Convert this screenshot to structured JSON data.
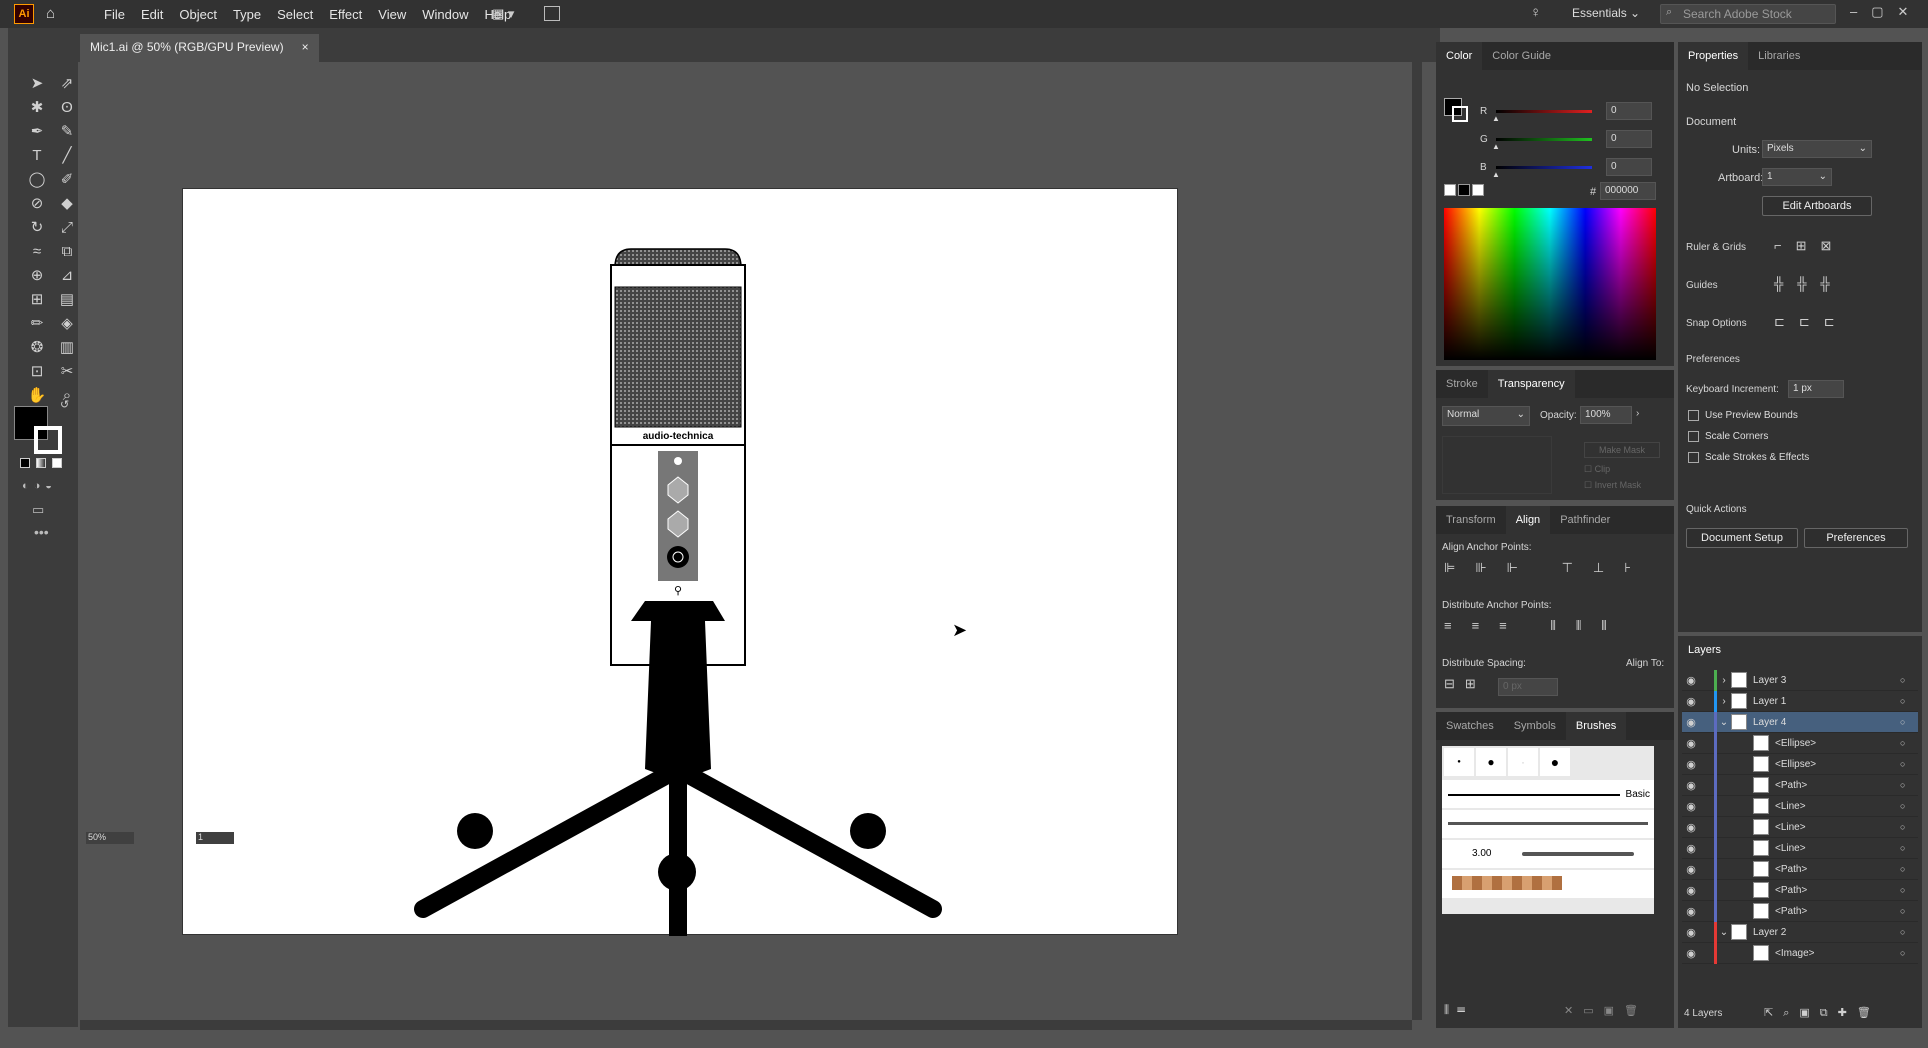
{
  "app": {
    "logo": "Ai",
    "home_icon": "home-icon"
  },
  "menu": [
    "File",
    "Edit",
    "Object",
    "Type",
    "Select",
    "Effect",
    "View",
    "Window",
    "Help"
  ],
  "header": {
    "workspace": "Essentials",
    "search_placeholder": "Search Adobe Stock"
  },
  "document": {
    "tab_title": "Mic1.ai @ 50% (RGB/GPU Preview)",
    "close": "×",
    "zoom": "50%",
    "artboard_num": "1"
  },
  "artwork": {
    "brand": "audio-technica"
  },
  "color_panel": {
    "tabs": [
      "Color",
      "Color Guide"
    ],
    "channels": [
      {
        "label": "R",
        "value": "0",
        "color": "#e02020"
      },
      {
        "label": "G",
        "value": "0",
        "color": "#20c020"
      },
      {
        "label": "B",
        "value": "0",
        "color": "#2030e0"
      }
    ],
    "hex_label": "#",
    "hex": "000000"
  },
  "transparency_panel": {
    "tabs": [
      "Stroke",
      "Transparency"
    ],
    "blend": "Normal",
    "opacity_label": "Opacity:",
    "opacity": "100%",
    "make_mask": "Make Mask",
    "clip": "Clip",
    "invert_mask": "Invert Mask"
  },
  "align_panel": {
    "tabs": [
      "Transform",
      "Align",
      "Pathfinder"
    ],
    "anchor_points": "Align Anchor Points:",
    "distribute": "Distribute Anchor Points:",
    "spacing": "Distribute Spacing:",
    "align_to": "Align To:",
    "spacing_value": "0 px"
  },
  "brushes_panel": {
    "tabs": [
      "Swatches",
      "Symbols",
      "Brushes"
    ],
    "basic": "Basic",
    "size": "3.00"
  },
  "properties": {
    "tabs": [
      "Properties",
      "Libraries"
    ],
    "no_selection": "No Selection",
    "document": "Document",
    "units_label": "Units:",
    "units": "Pixels",
    "artboard_label": "Artboard:",
    "artboard": "1",
    "edit_artboards": "Edit Artboards",
    "ruler_grids": "Ruler & Grids",
    "guides": "Guides",
    "snap_options": "Snap Options",
    "preferences": "Preferences",
    "keyboard_increment_label": "Keyboard Increment:",
    "keyboard_increment": "1 px",
    "checks": [
      "Use Preview Bounds",
      "Scale Corners",
      "Scale Strokes & Effects"
    ],
    "quick_actions": "Quick Actions",
    "document_setup": "Document Setup",
    "preferences_btn": "Preferences"
  },
  "layers": {
    "title": "Layers",
    "count": "4 Layers",
    "rows": [
      {
        "name": "Layer 3",
        "indent": 0,
        "arrow": "›",
        "color": "#4caf50"
      },
      {
        "name": "Layer 1",
        "indent": 0,
        "arrow": "›",
        "color": "#2196f3"
      },
      {
        "name": "Layer 4",
        "indent": 0,
        "arrow": "⌄",
        "color": "#5c6bc0",
        "selected": true
      },
      {
        "name": "<Ellipse>",
        "indent": 1,
        "arrow": "",
        "color": "#5c6bc0"
      },
      {
        "name": "<Ellipse>",
        "indent": 1,
        "arrow": "",
        "color": "#5c6bc0"
      },
      {
        "name": "<Path>",
        "indent": 1,
        "arrow": "",
        "color": "#5c6bc0"
      },
      {
        "name": "<Line>",
        "indent": 1,
        "arrow": "",
        "color": "#5c6bc0"
      },
      {
        "name": "<Line>",
        "indent": 1,
        "arrow": "",
        "color": "#5c6bc0"
      },
      {
        "name": "<Line>",
        "indent": 1,
        "arrow": "",
        "color": "#5c6bc0"
      },
      {
        "name": "<Path>",
        "indent": 1,
        "arrow": "",
        "color": "#5c6bc0"
      },
      {
        "name": "<Path>",
        "indent": 1,
        "arrow": "",
        "color": "#5c6bc0"
      },
      {
        "name": "<Path>",
        "indent": 1,
        "arrow": "",
        "color": "#5c6bc0"
      },
      {
        "name": "Layer 2",
        "indent": 0,
        "arrow": "⌄",
        "color": "#e53935"
      },
      {
        "name": "<Image>",
        "indent": 1,
        "arrow": "",
        "color": "#e53935"
      }
    ]
  }
}
